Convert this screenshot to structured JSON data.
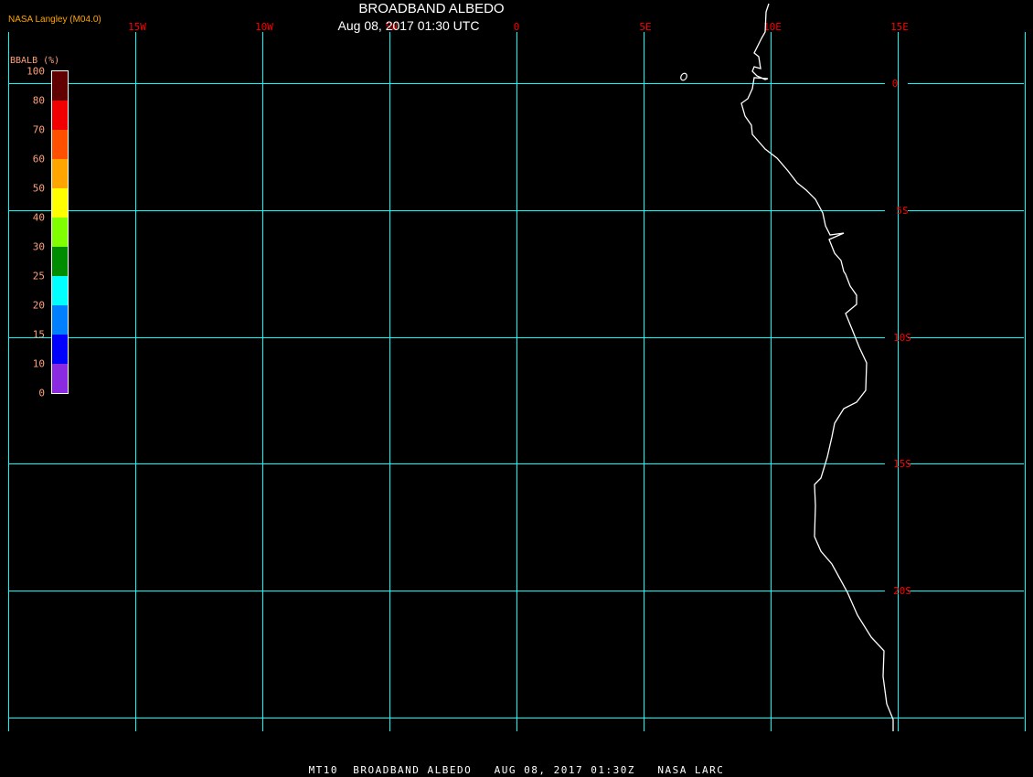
{
  "header": {
    "title": "BROADBAND ALBEDO",
    "subtitle": "Aug 08, 2017 01:30 UTC",
    "credit": "NASA Langley (M04.0)"
  },
  "colorbar": {
    "title": "BBALB (%)",
    "labels": [
      "100",
      "80",
      "70",
      "60",
      "50",
      "40",
      "30",
      "25",
      "20",
      "15",
      "10",
      "0"
    ],
    "colors": [
      "#600000",
      "#f00000",
      "#ff5000",
      "#ffa500",
      "#ffff00",
      "#80ff00",
      "#008c00",
      "#00ffff",
      "#0080ff",
      "#0000ff",
      "#8a2be2"
    ]
  },
  "map": {
    "longitude_labels": [
      "15W",
      "10W",
      "5W",
      "0",
      "5E",
      "10E",
      "15E"
    ],
    "latitude_labels": [
      "0",
      "5S",
      "10S",
      "15S",
      "20S"
    ],
    "grid_color": "#00ffff",
    "label_color": "#ff0000",
    "coastline_color": "#ffffff"
  },
  "footer": "MT10  BROADBAND ALBEDO   AUG 08, 2017 01:30Z   NASA LARC"
}
